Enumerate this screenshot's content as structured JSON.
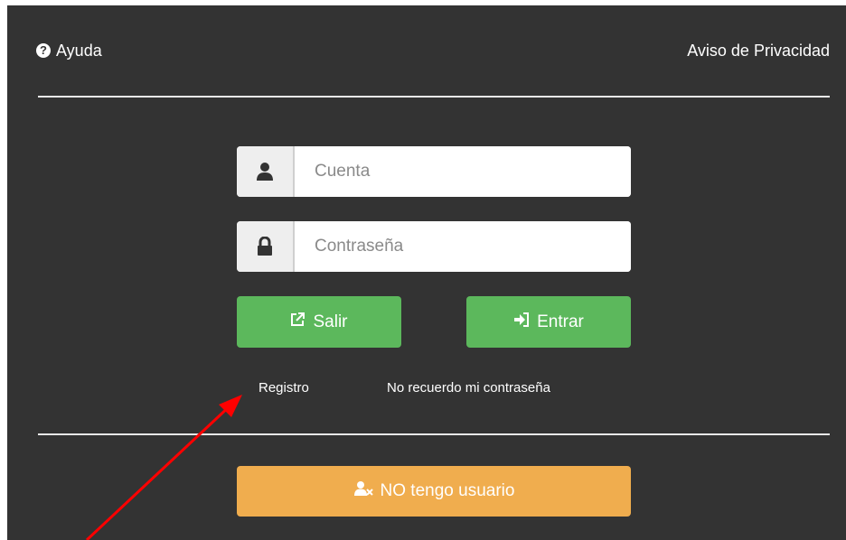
{
  "header": {
    "help_label": "Ayuda",
    "privacy_label": "Aviso de Privacidad"
  },
  "form": {
    "account_placeholder": "Cuenta",
    "password_placeholder": "Contraseña"
  },
  "buttons": {
    "exit_label": "Salir",
    "enter_label": "Entrar",
    "no_user_label": "NO tengo usuario"
  },
  "links": {
    "register": "Registro",
    "forgot_password": "No recuerdo mi contraseña"
  },
  "icons": {
    "help": "question-circle-icon",
    "account": "user-icon",
    "password": "lock-icon",
    "exit": "external-link-icon",
    "enter": "sign-in-icon",
    "no_user": "user-times-icon"
  },
  "colors": {
    "panel": "#333333",
    "success": "#5cb85c",
    "warning": "#f0ad4e",
    "annotation_arrow": "#ff0000"
  }
}
